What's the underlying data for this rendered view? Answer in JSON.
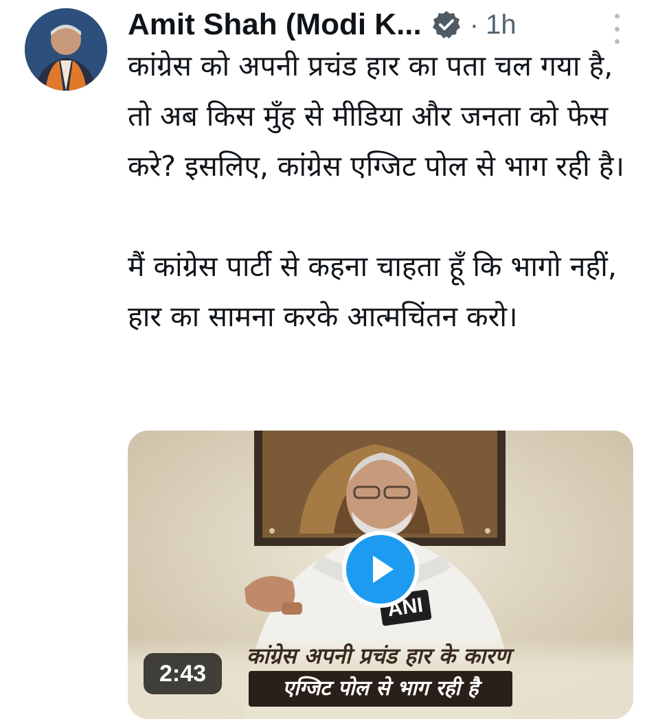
{
  "tweet": {
    "author_name": "Amit Shah (Modi K...",
    "separator": "·",
    "time": "1h",
    "paragraph_1": "कांग्रेस को अपनी प्रचंड हार का पता चल गया है, तो अब किस मुँह से मीडिया और जनता को फेस करे? इसलिए, कांग्रेस एग्जिट पोल से भाग रही है।",
    "paragraph_2": "मैं कांग्रेस पार्टी से कहना चाहता हूँ कि भागो नहीं, हार का सामना करके आत्मचिंतन करो।"
  },
  "video": {
    "duration": "2:43",
    "watermark": "ANI",
    "caption_line_1": "कांग्रेस अपनी प्रचंड हार के कारण",
    "caption_line_2": "एग्जिट पोल से भाग रही है"
  },
  "icons": {
    "verified": "verified-badge-icon",
    "more": "more-vertical-icon",
    "play": "play-icon"
  },
  "colors": {
    "verified": "#4f5a63",
    "play_button": "#1d9bf0",
    "text_secondary": "#536471"
  }
}
